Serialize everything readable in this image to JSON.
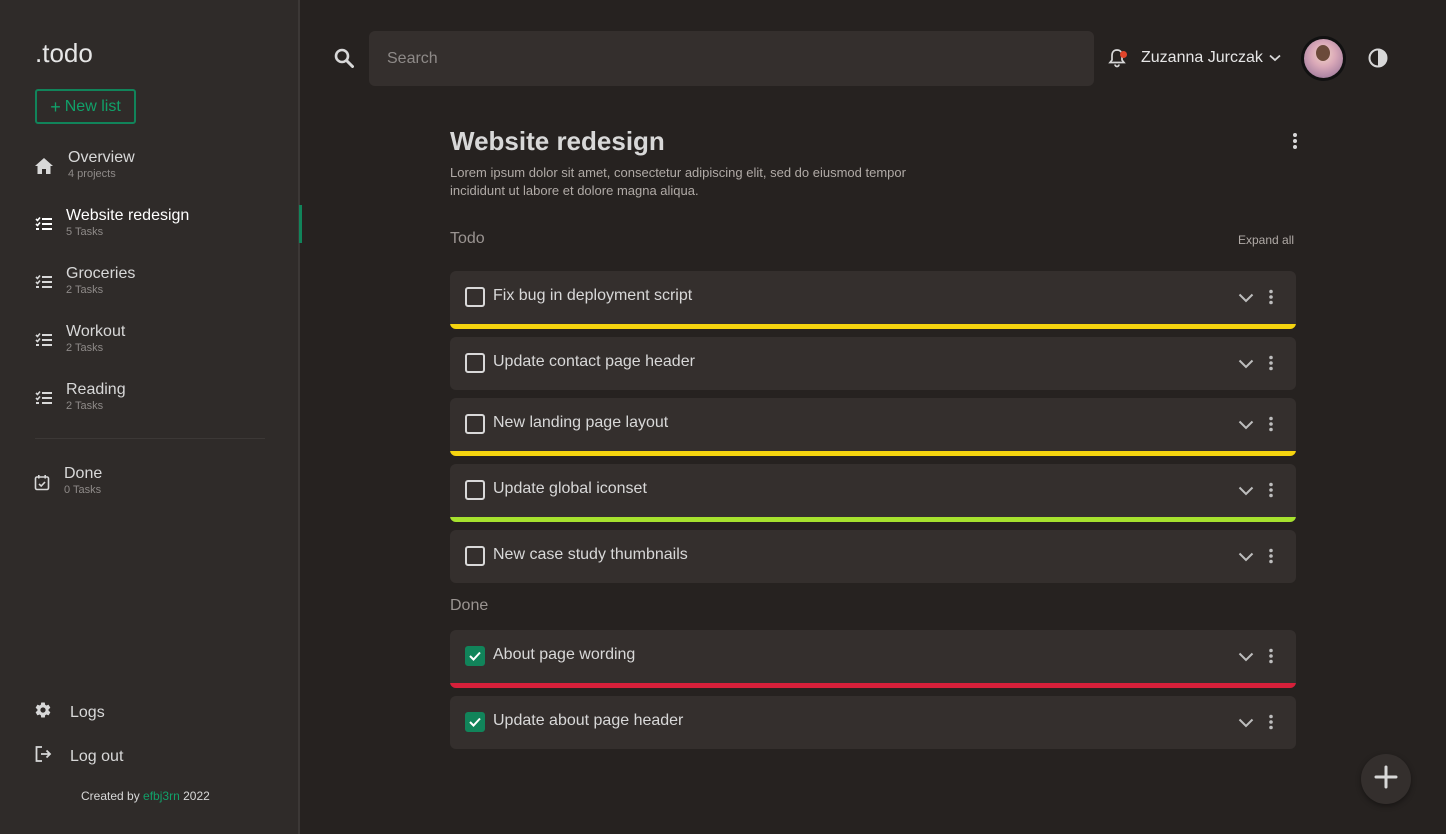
{
  "app": {
    "logo": ".todo",
    "new_list_label": "New list"
  },
  "sidebar": {
    "items": [
      {
        "name": "Overview",
        "sub": "4 projects",
        "icon": "home-icon"
      },
      {
        "name": "Website redesign",
        "sub": "5 Tasks",
        "icon": "list-icon",
        "active": true
      },
      {
        "name": "Groceries",
        "sub": "2 Tasks",
        "icon": "list-icon"
      },
      {
        "name": "Workout",
        "sub": "2 Tasks",
        "icon": "list-icon"
      },
      {
        "name": "Reading",
        "sub": "2 Tasks",
        "icon": "list-icon"
      }
    ],
    "done": {
      "name": "Done",
      "sub": "0 Tasks",
      "icon": "calendar-check-icon"
    },
    "logs_label": "Logs",
    "logout_label": "Log out",
    "credits": {
      "prefix": "Created by",
      "author": "efbj3rn",
      "year": "2022"
    }
  },
  "header": {
    "search_placeholder": "Search",
    "username": "Zuzanna Jurczak"
  },
  "project": {
    "title": "Website redesign",
    "description": "Lorem ipsum dolor sit amet, consectetur adipiscing elit, sed do eiusmod tempor incididunt ut labore et dolore magna aliqua.",
    "todo_label": "Todo",
    "expand_all_label": "Expand all",
    "done_label": "Done",
    "todo_tasks": [
      {
        "title": "Fix bug in deployment script",
        "priority_color": "#f5d40f"
      },
      {
        "title": "Update contact page header",
        "priority_color": ""
      },
      {
        "title": "New landing page layout",
        "priority_color": "#f5d40f"
      },
      {
        "title": "Update global iconset",
        "priority_color": "#a6e22e"
      },
      {
        "title": "New case study thumbnails",
        "priority_color": ""
      }
    ],
    "done_tasks": [
      {
        "title": "About page wording",
        "priority_color": "#d6203a"
      },
      {
        "title": "Update about page header",
        "priority_color": ""
      }
    ]
  },
  "colors": {
    "accent": "#11845a",
    "background": "#262220",
    "sidebar": "#2f2b29",
    "card": "#342f2d"
  }
}
